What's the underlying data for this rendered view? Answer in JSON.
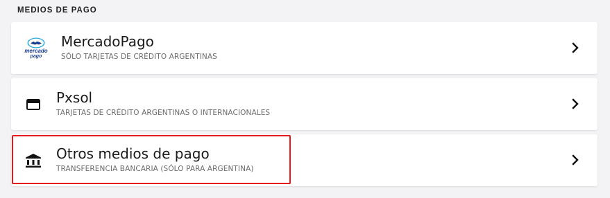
{
  "section": {
    "title": "MEDIOS DE PAGO"
  },
  "methods": [
    {
      "title": "MercadoPago",
      "subtitle": "SÓLO TARJETAS DE CRÉDITO ARGENTINAS",
      "icon": "mercadopago-logo",
      "logo_text_line1": "mercado",
      "logo_text_line2": "pago"
    },
    {
      "title": "Pxsol",
      "subtitle": "TARJETAS DE CRÉDITO ARGENTINAS O INTERNACIONALES",
      "icon": "credit-card-icon"
    },
    {
      "title": "Otros medios de pago",
      "subtitle": "TRANSFERENCIA BANCARIA (SÓLO PARA ARGENTINA)",
      "icon": "bank-icon",
      "highlighted": true
    }
  ],
  "colors": {
    "highlight": "#e5191b",
    "mercadopago_blue": "#1b3d8f",
    "mercadopago_light": "#27a8e0"
  }
}
